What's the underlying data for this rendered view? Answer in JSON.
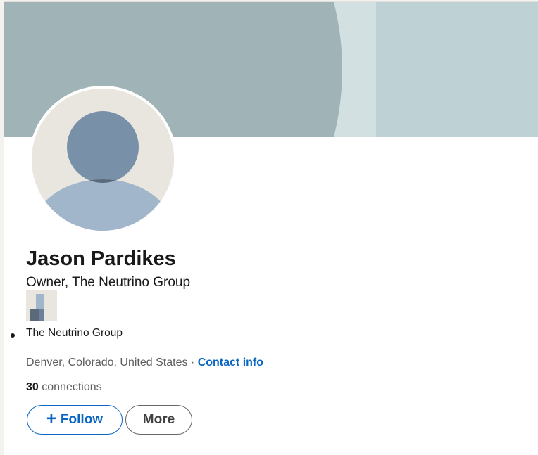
{
  "profile": {
    "name": "Jason Pardikes",
    "headline": "Owner, The Neutrino Group",
    "companies": [
      "The Neutrino Group"
    ],
    "location": "Denver, Colorado, United States",
    "separator": "·",
    "contact_label": "Contact info",
    "connections_count": "30",
    "connections_label": "connections"
  },
  "actions": {
    "follow_icon": "+",
    "follow_label": "Follow",
    "more_label": "More"
  },
  "icons": {
    "avatar": "default-person-avatar",
    "company_logo": "company-logo-placeholder",
    "follow": "plus-icon"
  },
  "colors": {
    "brand_blue": "#0a66c2",
    "banner": "#a0b4b7",
    "avatar_bg": "#e9e5df",
    "text_primary": "#191919",
    "text_secondary": "#5e5e5e"
  }
}
